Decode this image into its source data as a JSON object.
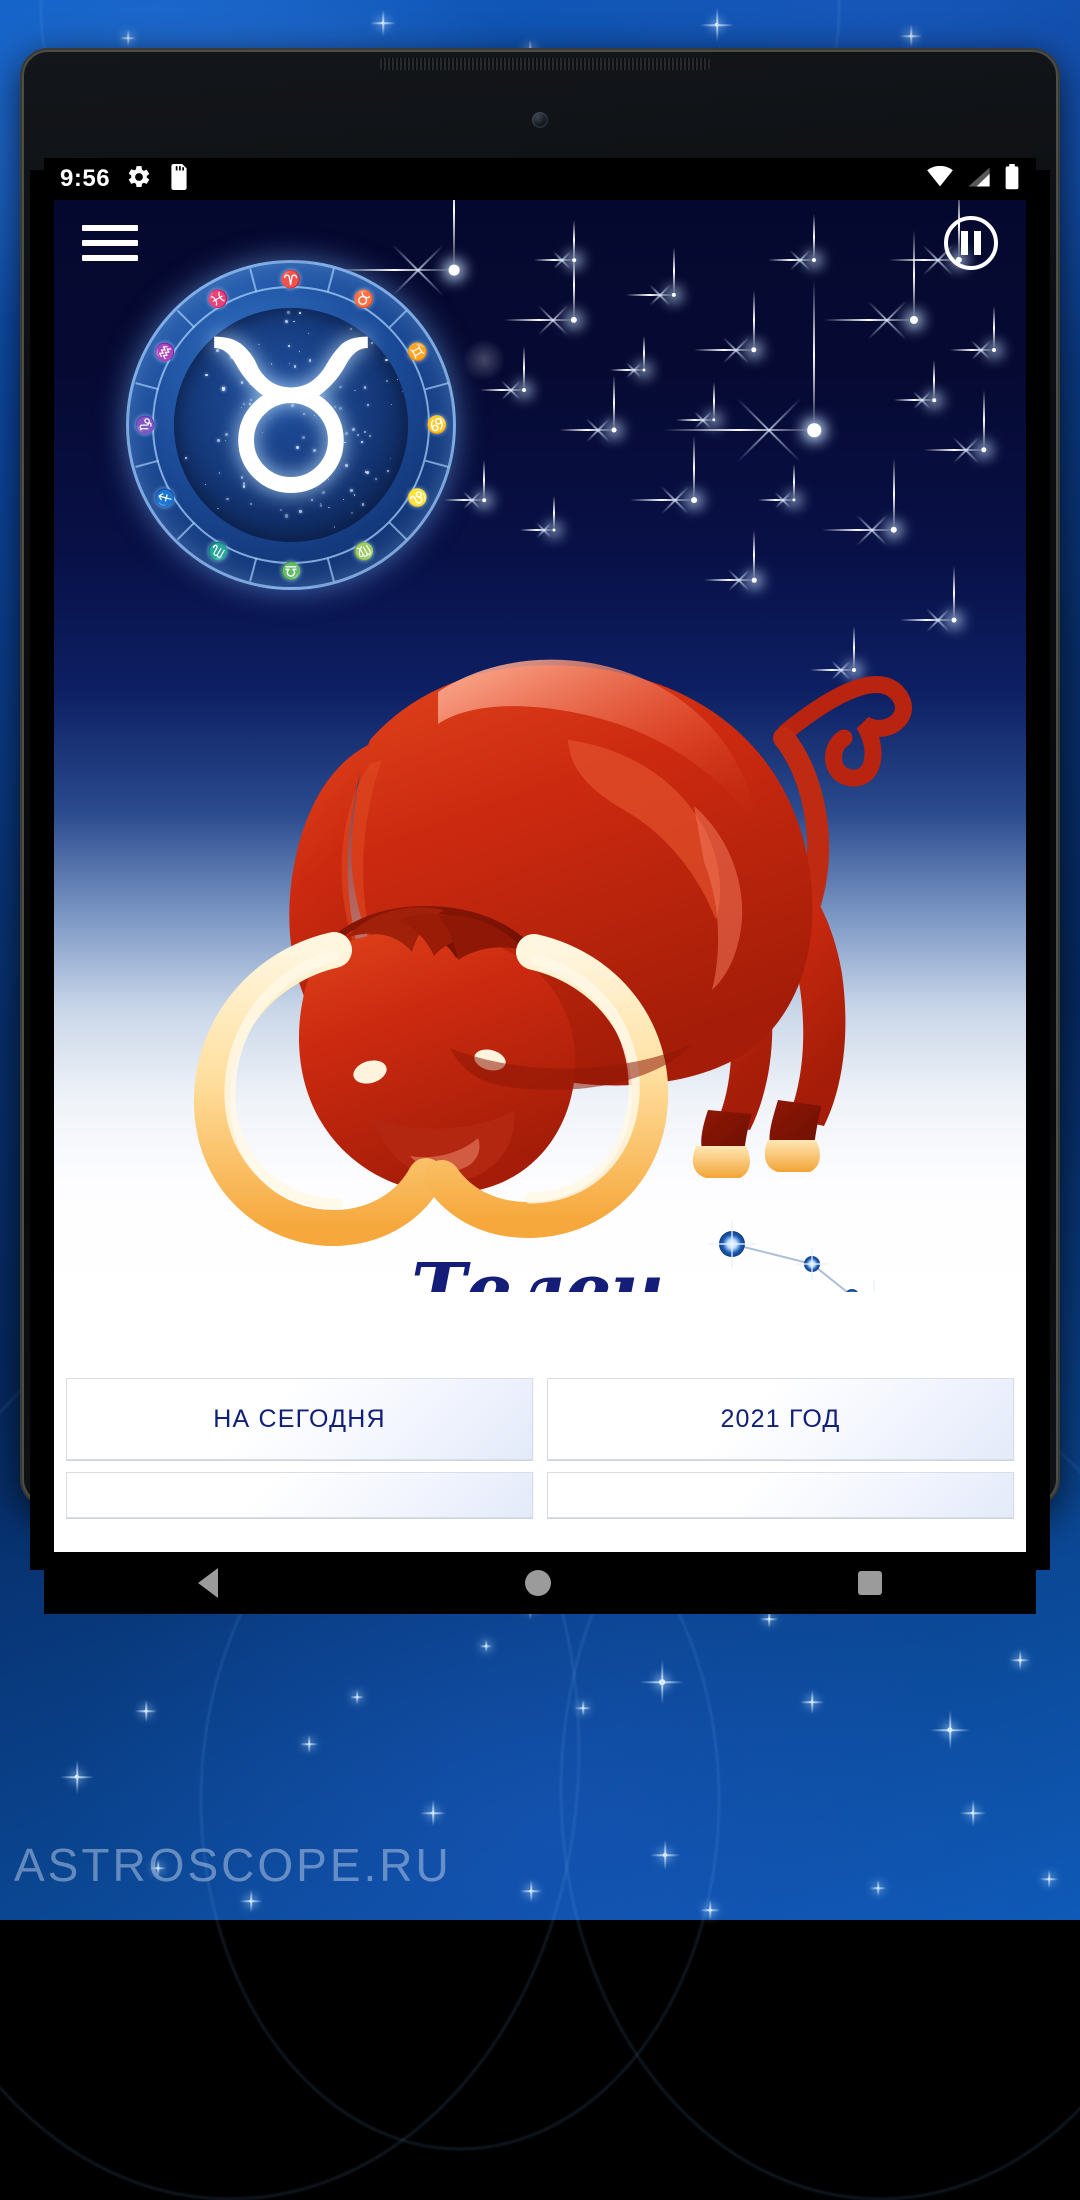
{
  "wallpaper": {
    "watermark": "ASTROSCOPE.RU"
  },
  "status_bar": {
    "time": "9:56",
    "icons": [
      "gear-icon",
      "sd-card-icon",
      "wifi-icon",
      "signal-icon",
      "battery-icon"
    ]
  },
  "app": {
    "toolbar": {
      "menu_label": "menu-icon",
      "pause_label": "pause-icon"
    },
    "hero": {
      "medallion_glyph": "♉",
      "zodiac_ring_glyphs": [
        "♈",
        "♉",
        "♊",
        "♋",
        "♌",
        "♍",
        "♎",
        "♏",
        "♐",
        "♑",
        "♒",
        "♓"
      ],
      "illustration": "red-bull-illustration",
      "constellation": "taurus-constellation"
    },
    "sign_title": "Телец",
    "buttons": [
      {
        "label": "НА СЕГОДНЯ"
      },
      {
        "label": "2021 ГОД"
      },
      {
        "label": ""
      },
      {
        "label": ""
      }
    ]
  },
  "navigation_bar": {
    "back": "back-icon",
    "home": "home-icon",
    "recents": "recents-icon"
  },
  "colors": {
    "accent_navy": "#141e78",
    "button_text": "#10207a",
    "hero_top": "#05082e",
    "bull_red": "#cc2a10"
  }
}
